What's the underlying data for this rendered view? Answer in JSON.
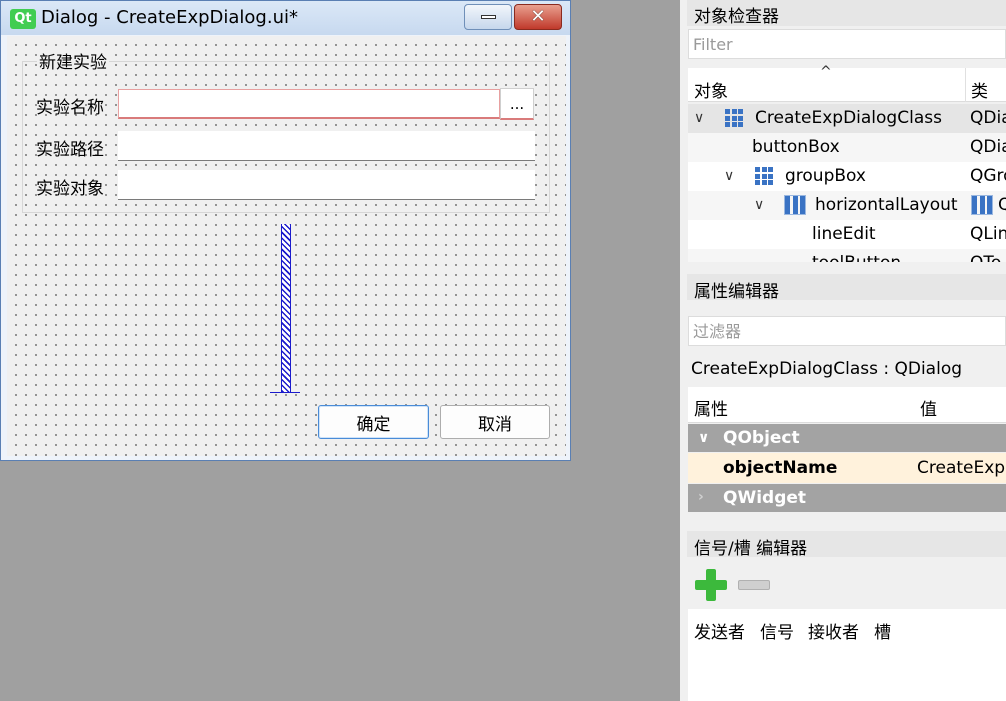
{
  "dialog": {
    "window_title": "Dialog - CreateExpDialog.ui*",
    "logo_text": "Qt",
    "minimize_glyph": "",
    "close_glyph": "✕",
    "group_title": "新建实验",
    "fields": [
      {
        "label": "实验名称",
        "value": ""
      },
      {
        "label": "实验路径",
        "value": ""
      },
      {
        "label": "实验对象",
        "value": ""
      }
    ],
    "browse_label": "...",
    "ok_label": "确定",
    "cancel_label": "取消"
  },
  "object_inspector": {
    "title": "对象检查器",
    "filter_placeholder": "Filter",
    "columns": [
      "对象",
      "类"
    ],
    "rows": [
      {
        "name": "CreateExpDialogClass",
        "class": "QDia"
      },
      {
        "name": "buttonBox",
        "class": "QDia"
      },
      {
        "name": "groupBox",
        "class": "QGro"
      },
      {
        "name": "horizontalLayout",
        "class": "Q"
      },
      {
        "name": "lineEdit",
        "class": "QLin"
      },
      {
        "name": "toolButton",
        "class": "QTo"
      }
    ]
  },
  "property_editor": {
    "title": "属性编辑器",
    "filter_placeholder": "过滤器",
    "class_line": "CreateExpDialogClass : QDialog",
    "columns": [
      "属性",
      "值"
    ],
    "group_qobject": "QObject",
    "property_name": "objectName",
    "property_value": "CreateExpD",
    "group_qwidget": "QWidget"
  },
  "signal_slot_editor": {
    "title": "信号/槽 编辑器",
    "columns": [
      "发送者",
      "信号",
      "接收者",
      "槽"
    ]
  },
  "colors": {
    "accent": "#4a8cd8",
    "focus_underline": "#d97b7b",
    "spacer": "#1a1acc",
    "layout_icon": "#3a73c4",
    "group_row": "#a3a3a3",
    "selected_property": "#fff2dc",
    "plus": "#3cb93c"
  }
}
